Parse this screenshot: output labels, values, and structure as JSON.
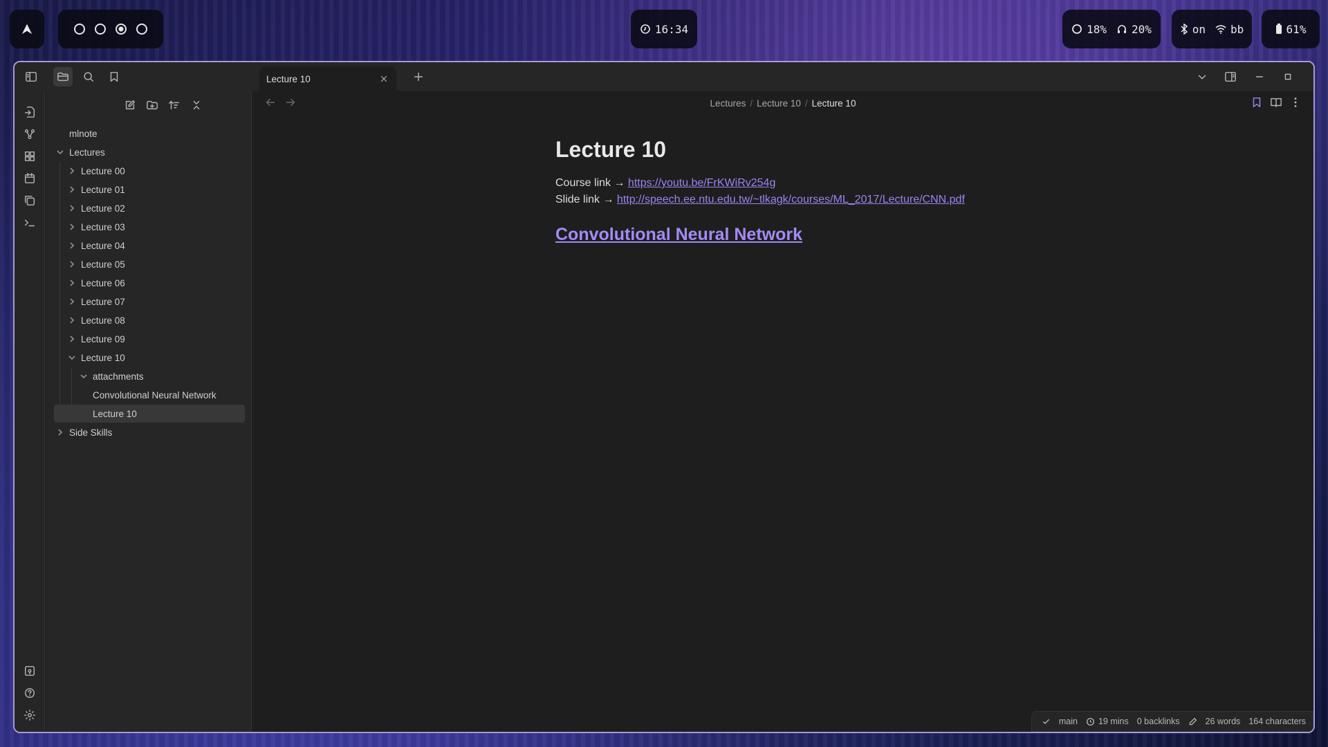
{
  "topbar": {
    "clock": "16:34",
    "cpu": "18%",
    "audio": "20%",
    "bluetooth": "on",
    "wifi": "bb",
    "battery": "61%",
    "workspaces": 4,
    "active_workspace": 3
  },
  "tabs": [
    {
      "label": "Lecture 10"
    }
  ],
  "breadcrumb": [
    "Lectures",
    "Lecture 10",
    "Lecture 10"
  ],
  "sidebar": {
    "vault": "mlnote",
    "items": [
      {
        "label": "Lectures",
        "depth": 0,
        "expanded": true
      },
      {
        "label": "Lecture 00",
        "depth": 1,
        "expanded": false
      },
      {
        "label": "Lecture 01",
        "depth": 1,
        "expanded": false
      },
      {
        "label": "Lecture 02",
        "depth": 1,
        "expanded": false
      },
      {
        "label": "Lecture 03",
        "depth": 1,
        "expanded": false
      },
      {
        "label": "Lecture 04",
        "depth": 1,
        "expanded": false
      },
      {
        "label": "Lecture 05",
        "depth": 1,
        "expanded": false
      },
      {
        "label": "Lecture 06",
        "depth": 1,
        "expanded": false
      },
      {
        "label": "Lecture 07",
        "depth": 1,
        "expanded": false
      },
      {
        "label": "Lecture 08",
        "depth": 1,
        "expanded": false
      },
      {
        "label": "Lecture 09",
        "depth": 1,
        "expanded": false
      },
      {
        "label": "Lecture 10",
        "depth": 1,
        "expanded": true
      },
      {
        "label": "attachments",
        "depth": 2,
        "expanded": true
      },
      {
        "label": "Convolutional Neural Network",
        "depth": 2,
        "file": true
      },
      {
        "label": "Lecture 10",
        "depth": 2,
        "file": true,
        "selected": true
      },
      {
        "label": "Side Skills",
        "depth": 0,
        "expanded": false
      }
    ]
  },
  "doc": {
    "title": "Lecture 10",
    "course_prefix": "Course link → ",
    "course_link": "https://youtu.be/FrKWiRv254g",
    "slide_prefix": "Slide link → ",
    "slide_link": "http://speech.ee.ntu.edu.tw/~tlkagk/courses/ML_2017/Lecture/CNN.pdf",
    "heading_link": "Convolutional Neural Network"
  },
  "status": {
    "branch": "main",
    "time": "19 mins",
    "backlinks": "0 backlinks",
    "words": "26 words",
    "chars": "164 characters"
  }
}
